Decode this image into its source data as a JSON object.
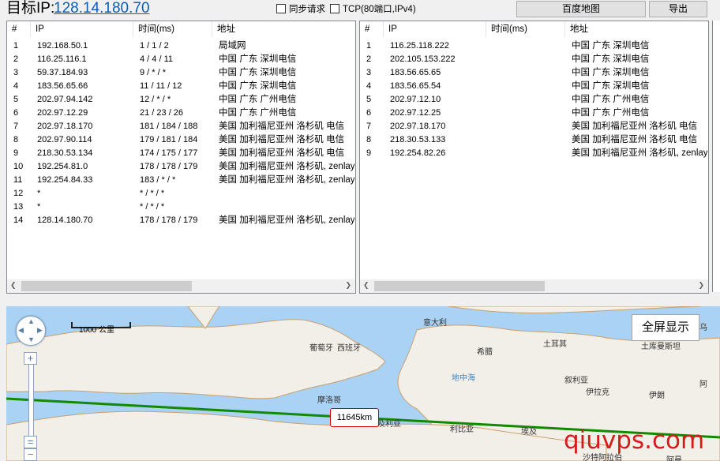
{
  "header": {
    "target_label": "目标IP:",
    "target_ip": "128.14.180.70",
    "sync_label": "同步请求",
    "tcp_label": "TCP(80端口,IPv4)",
    "map_button": "百度地图",
    "export_button": "导出"
  },
  "left_table": {
    "columns": [
      "#",
      "IP",
      "时间(ms)",
      "地址"
    ],
    "rows": [
      [
        "1",
        "192.168.50.1",
        "1 / 1 / 2",
        "局域网"
      ],
      [
        "2",
        "116.25.116.1",
        "4 / 4 / 11",
        "中国 广东 深圳电信"
      ],
      [
        "3",
        "59.37.184.93",
        "9 / * / *",
        "中国 广东 深圳电信"
      ],
      [
        "4",
        "183.56.65.66",
        "11 / 11 / 12",
        "中国 广东 深圳电信"
      ],
      [
        "5",
        "202.97.94.142",
        "12 / * / *",
        "中国 广东 广州电信"
      ],
      [
        "6",
        "202.97.12.29",
        "21 / 23 / 26",
        "中国 广东 广州电信"
      ],
      [
        "7",
        "202.97.18.170",
        "181 / 184 / 188",
        "美国 加利福尼亚州 洛杉矶 电信"
      ],
      [
        "8",
        "202.97.90.114",
        "179 / 181 / 184",
        "美国 加利福尼亚州 洛杉矶 电信"
      ],
      [
        "9",
        "218.30.53.134",
        "174 / 175 / 177",
        "美国 加利福尼亚州 洛杉矶 电信"
      ],
      [
        "10",
        "192.254.81.0",
        "178 / 178 / 179",
        "美国 加利福尼亚州 洛杉矶, zenlaye"
      ],
      [
        "11",
        "192.254.84.33",
        "183 / * / *",
        "美国 加利福尼亚州 洛杉矶, zenlaye"
      ],
      [
        "12",
        "*",
        "* / * / *",
        ""
      ],
      [
        "13",
        "*",
        "* / * / *",
        ""
      ],
      [
        "14",
        "128.14.180.70",
        "178 / 178 / 179",
        "美国 加利福尼亚州 洛杉矶, zenlaye"
      ]
    ]
  },
  "right_table": {
    "columns": [
      "#",
      "IP",
      "时间(ms)",
      "地址"
    ],
    "rows": [
      [
        "1",
        "116.25.118.222",
        "",
        "中国 广东 深圳电信"
      ],
      [
        "2",
        "202.105.153.222",
        "",
        "中国 广东 深圳电信"
      ],
      [
        "3",
        "183.56.65.65",
        "",
        "中国 广东 深圳电信"
      ],
      [
        "4",
        "183.56.65.54",
        "",
        "中国 广东 深圳电信"
      ],
      [
        "5",
        "202.97.12.10",
        "",
        "中国 广东 广州电信"
      ],
      [
        "6",
        "202.97.12.25",
        "",
        "中国 广东 广州电信"
      ],
      [
        "7",
        "202.97.18.170",
        "",
        "美国 加利福尼亚州 洛杉矶 电信"
      ],
      [
        "8",
        "218.30.53.133",
        "",
        "美国 加利福尼亚州 洛杉矶 电信"
      ],
      [
        "9",
        "192.254.82.26",
        "",
        "美国 加利福尼亚州 洛杉矶, zenlaye"
      ]
    ]
  },
  "map": {
    "scale_label": "1000 公里",
    "fullscreen_button": "全屏显示",
    "distance_label": "11645km",
    "place_labels": [
      "意大利",
      "葡萄牙",
      "西班牙",
      "希腊",
      "土耳其",
      "土库曼斯坦",
      "地中海",
      "叙利亚",
      "伊拉克",
      "伊朗",
      "摩洛哥",
      "埃及",
      "利比亚",
      "沙特阿拉伯",
      "阿曼",
      "乌",
      "阿",
      "及利亚"
    ],
    "route_color": "#118a00",
    "watermark": "qiuvps.com"
  }
}
